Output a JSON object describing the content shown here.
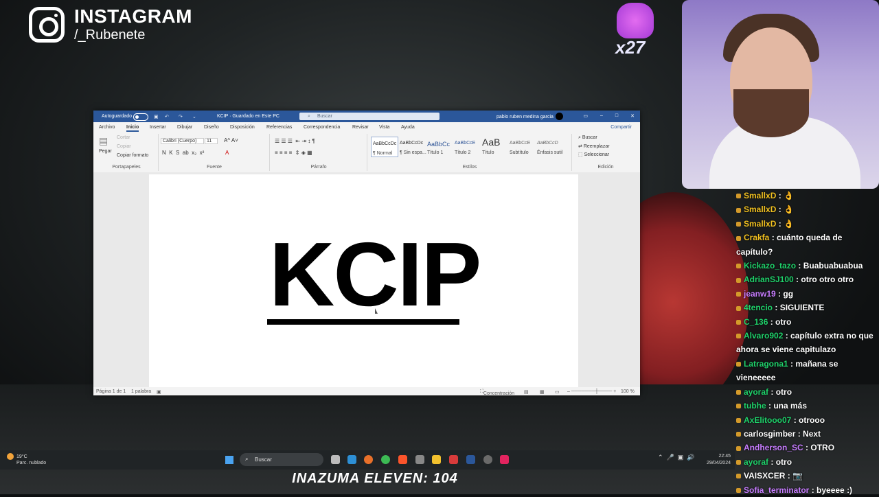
{
  "overlay": {
    "instagram_title": "INSTAGRAM",
    "instagram_handle": "/_Rubenete",
    "reaction_count": "x27",
    "bottom_banner": "INAZUMA ELEVEN: 104"
  },
  "word": {
    "autosave_label": "Autoguardado",
    "doc_title": "KCIP · Guardado en Este PC",
    "search_placeholder": "Buscar",
    "user_name": "pablo ruben medina garcia",
    "share_label": "Compartir",
    "menu": [
      "Archivo",
      "Inicio",
      "Insertar",
      "Dibujar",
      "Diseño",
      "Disposición",
      "Referencias",
      "Correspondencia",
      "Revisar",
      "Vista",
      "Ayuda"
    ],
    "ribbon": {
      "paste": "Pegar",
      "cut": "Cortar",
      "copy": "Copiar",
      "copy_format": "Copiar formato",
      "clipboard_group": "Portapapeles",
      "font_name": "Calibri (Cuerpo)",
      "font_size": "11",
      "font_group": "Fuente",
      "paragraph_group": "Párrafo",
      "styles_group": "Estilos",
      "styles": [
        {
          "sample": "AaBbCcDc",
          "name": "¶ Normal"
        },
        {
          "sample": "AaBbCcDc",
          "name": "¶ Sin espa..."
        },
        {
          "sample": "AaBbCc",
          "name": "Título 1"
        },
        {
          "sample": "AaBbCcE",
          "name": "Título 2"
        },
        {
          "sample": "AaB",
          "name": "Título"
        },
        {
          "sample": "AaBbCcE",
          "name": "Subtítulo"
        },
        {
          "sample": "AaBbCcD",
          "name": "Énfasis sutil"
        }
      ],
      "find": "Buscar",
      "replace": "Reemplazar",
      "select": "Seleccionar",
      "editing_group": "Edición"
    },
    "document_text": "KCIP",
    "status": {
      "page": "Página 1 de 1",
      "words": "1 palabra",
      "focus": "Concentración",
      "zoom": "100 %"
    }
  },
  "chat": [
    {
      "user": "SmallxD",
      "msg": "👌",
      "color": "#f0c020"
    },
    {
      "user": "SmallxD",
      "msg": "👌",
      "color": "#f0c020"
    },
    {
      "user": "SmallxD",
      "msg": "👌",
      "color": "#f0c020"
    },
    {
      "user": "Crakfa",
      "msg": "cuánto queda de capítulo?",
      "color": "#f0c020"
    },
    {
      "user": "Kickazo_tazo",
      "msg": "Buabuabuabua",
      "color": "#1fd36b"
    },
    {
      "user": "AdrianSJ100",
      "msg": "otro otro otro",
      "color": "#1fd36b"
    },
    {
      "user": "jeanw19",
      "msg": "gg",
      "color": "#c77dff"
    },
    {
      "user": "4tencio",
      "msg": "SIGUIENTE",
      "color": "#1fd36b"
    },
    {
      "user": "C_136",
      "msg": "otro",
      "color": "#1fd36b"
    },
    {
      "user": "Alvaro902",
      "msg": "capítulo extra no que ahora se viene capitulazo",
      "color": "#1fd36b"
    },
    {
      "user": "Latragona1",
      "msg": "mañana se vieneeeee",
      "color": "#1fd36b"
    },
    {
      "user": "ayoraf",
      "msg": "otro",
      "color": "#1fd36b"
    },
    {
      "user": "tubhe",
      "msg": "una más",
      "color": "#1fd36b"
    },
    {
      "user": "AxElitooo07",
      "msg": "otrooo",
      "color": "#1fd36b"
    },
    {
      "user": "carlosgimber",
      "msg": "Next",
      "color": "#ffffff"
    },
    {
      "user": "Andherson_SC",
      "msg": "OTRO",
      "color": "#c77dff"
    },
    {
      "user": "ayoraf",
      "msg": "otro",
      "color": "#1fd36b"
    },
    {
      "user": "VAISXCER",
      "msg": "📷",
      "color": "#ffffff"
    },
    {
      "user": "Sofia_terminator",
      "msg": "byeeee :)",
      "color": "#c77dff"
    }
  ],
  "taskbar": {
    "temp": "19°C",
    "weather": "Parc. nublado",
    "search": "Buscar",
    "time": "22:45",
    "date": "29/04/2024"
  }
}
